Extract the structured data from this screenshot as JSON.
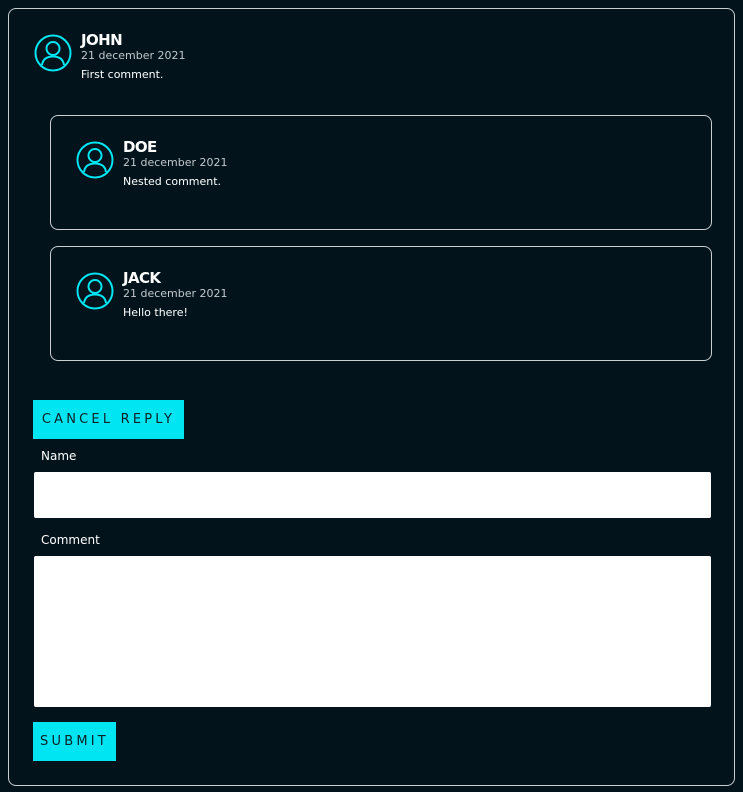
{
  "comments": {
    "top": {
      "author": "JOHN",
      "date": "21 december 2021",
      "text": "First comment."
    },
    "replies": [
      {
        "author": "DOE",
        "date": "21 december 2021",
        "text": "Nested comment."
      },
      {
        "author": "JACK",
        "date": "21 december 2021",
        "text": "Hello there!"
      }
    ]
  },
  "form": {
    "cancel_label": "CANCEL REPLY",
    "name_label": "Name",
    "name_value": "",
    "comment_label": "Comment",
    "comment_value": "",
    "submit_label": "SUBMIT"
  },
  "colors": {
    "background": "#02131c",
    "accent": "#00e5f2",
    "border": "#c9cfd2"
  },
  "icons": {
    "avatar": "user-circle-icon"
  }
}
